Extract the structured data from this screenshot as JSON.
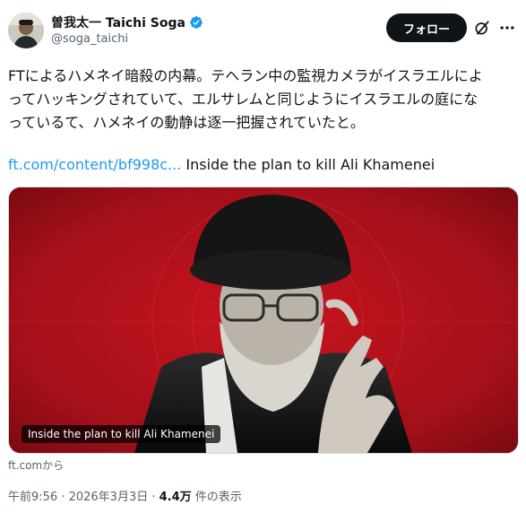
{
  "author": {
    "display_name": "曽我太一 Taichi Soga",
    "handle": "@soga_taichi"
  },
  "header": {
    "follow_label": "フォロー"
  },
  "tweet": {
    "lines": [
      "FTによるハメネイ暗殺の内幕。テヘラン中の監視カメラがイスラエルによ",
      "ってハッキングされていて、エルサレムと同じようにイスラエルの庭にな",
      "っているて、ハメネイの動静は逐一把握されていたと。"
    ],
    "link_text": "ft.com/content/bf998c...",
    "link_title": "Inside the plan to kill Ali Khamenei"
  },
  "card": {
    "caption": "Inside the plan to kill Ali Khamenei",
    "source": "ft.comから"
  },
  "meta": {
    "time_date": "午前9:56 · 2026年3月3日 · ",
    "views_count": "4.4万",
    "views_label": " 件の表示"
  },
  "colors": {
    "accent": "#1d9bf0",
    "text": "#0f1419",
    "muted": "#536471",
    "media_bg": "#b5121b"
  }
}
